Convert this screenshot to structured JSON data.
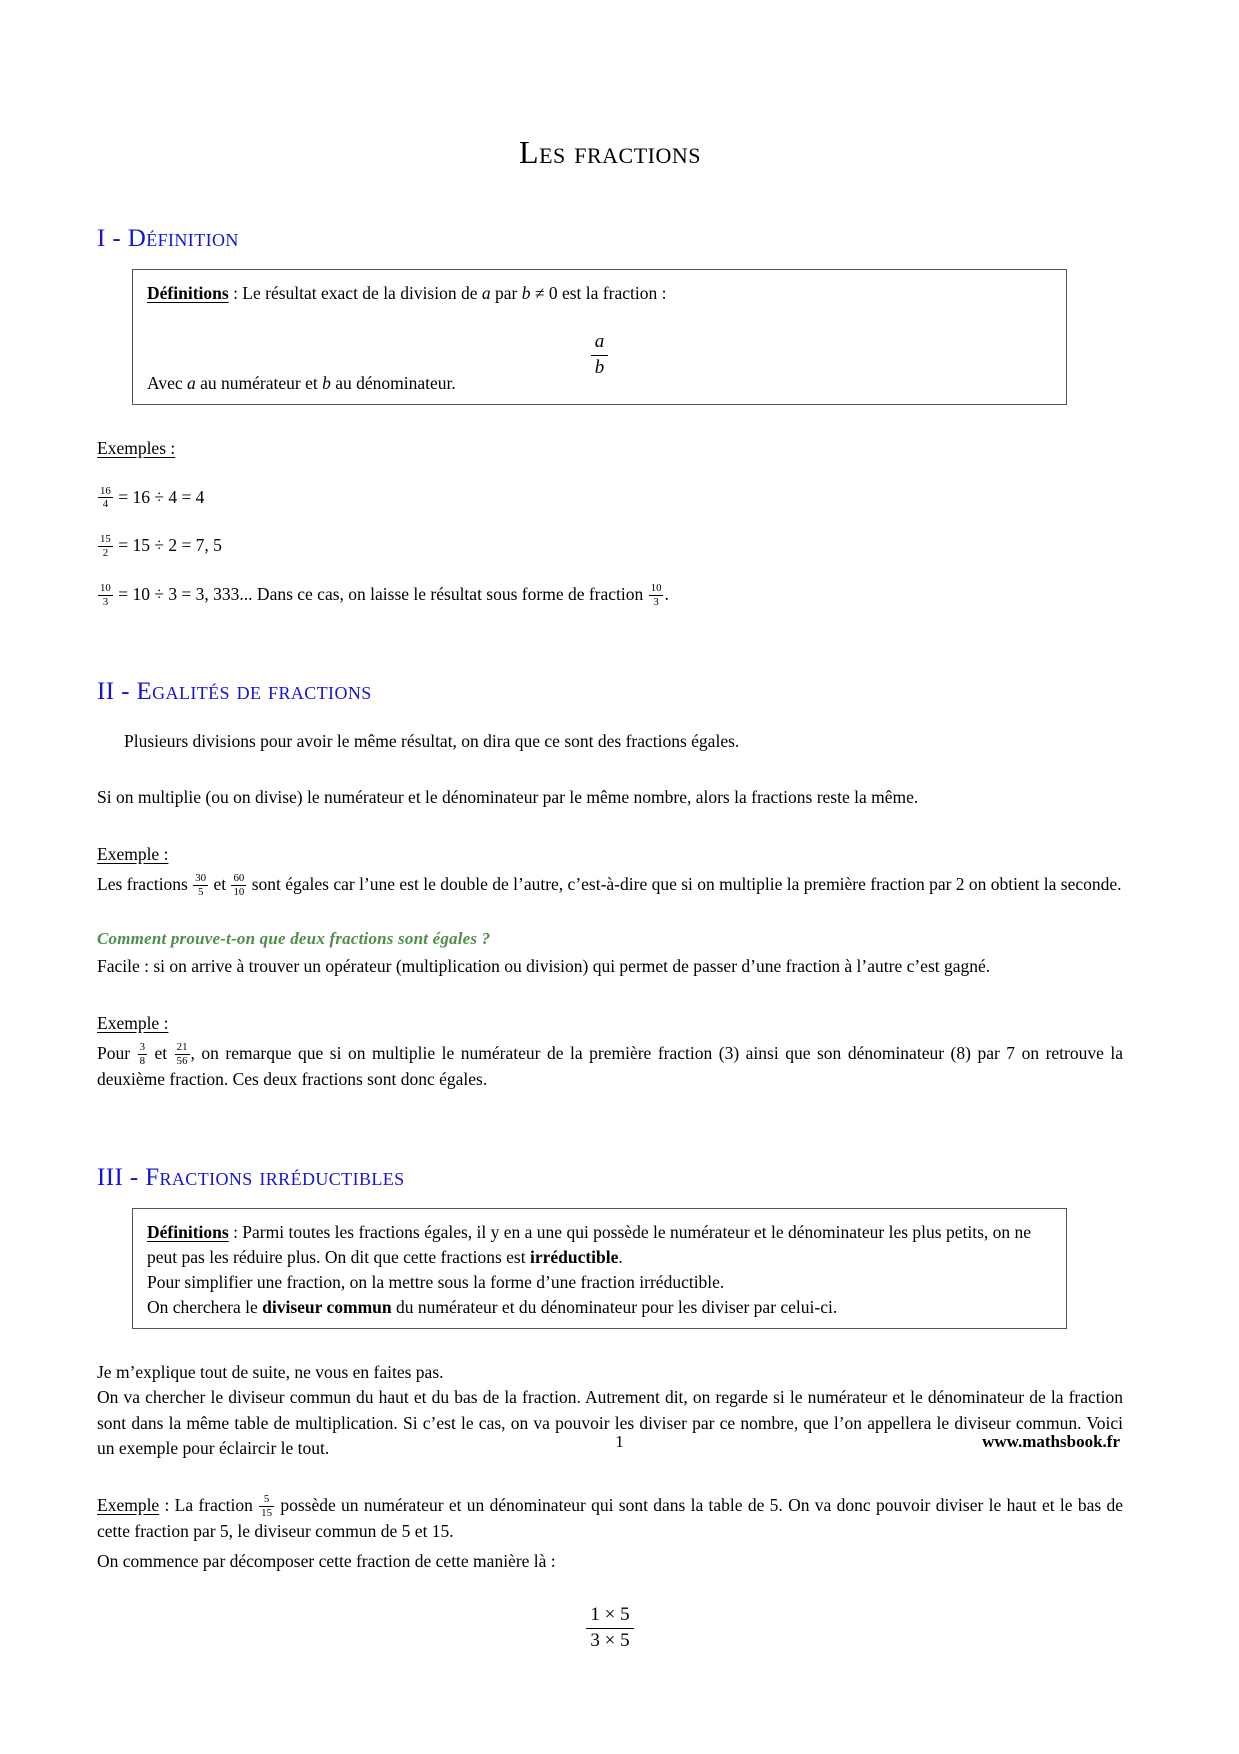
{
  "document": {
    "title": "Les fractions",
    "page_number": "1",
    "site_url": "www.mathsbook.fr"
  },
  "sections": [
    {
      "heading": "I - Définition",
      "definition_box": {
        "label": "Définitions",
        "label_suffix": " : Le résultat exact de la division de ",
        "var_a": "a",
        "mid_text": " par ",
        "var_b": "b",
        "condition": " ≠ 0 est la fraction :",
        "formula_num": "a",
        "formula_den": "b",
        "closing_prefix": "Avec ",
        "closing_a": "a",
        "closing_mid": " au numérateur et ",
        "closing_b": "b",
        "closing_suffix": " au dénominateur."
      },
      "examples_label": "Exemples :",
      "examples": [
        {
          "num": "16",
          "den": "4",
          "text": "= 16 ÷ 4 = 4"
        },
        {
          "num": "15",
          "den": "2",
          "text": "= 15 ÷ 2 = 7, 5"
        },
        {
          "num": "10",
          "den": "3",
          "text": "= 10 ÷ 3 = 3, 333... Dans ce cas, on laisse le résultat sous forme de fraction",
          "trailing_num": "10",
          "trailing_den": "3",
          "trailing_text": "."
        }
      ]
    },
    {
      "heading": "II - Egalités de fractions",
      "para1": "Plusieurs divisions pour avoir le même résultat, on dira que ce sont des fractions égales.",
      "para2": "Si on multiplie (ou on divise) le numérateur et le dénominateur par le même nombre, alors la fractions reste la même.",
      "example1_label": "Exemple :",
      "example1_prefix": "Les fractions",
      "example1_frac1": {
        "num": "30",
        "den": "5"
      },
      "example1_conj": "et",
      "example1_frac2": {
        "num": "60",
        "den": "10"
      },
      "example1_text": "sont égales car l’une est le double de l’autre, c’est-à-dire que si on multiplie la première fraction par 2 on obtient la seconde.",
      "green_question": "Comment prouve-t-on que deux fractions sont égales ?",
      "answer": "Facile : si on arrive à trouver un opérateur (multiplication ou division) qui permet de passer d’une fraction à l’autre c’est gagné.",
      "example2_label": "Exemple :",
      "example2_prefix": "Pour",
      "example2_frac1": {
        "num": "3",
        "den": "8"
      },
      "example2_conj": "et",
      "example2_frac2": {
        "num": "21",
        "den": "56"
      },
      "example2_text": ", on remarque que si on multiplie le numérateur de la première fraction (3) ainsi que son dénominateur (8) par 7 on retrouve la deuxième fraction. Ces deux fractions sont donc égales."
    },
    {
      "heading": "III - Fractions irréductibles",
      "definition_box": {
        "label": "Définitions",
        "line1_a": " : Parmi toutes les fractions égales, il y en a une qui possède le numérateur et le dénominateur les plus petits, on ne peut pas les réduire plus. On dit que cette fractions est ",
        "line1_bold": "irréductible",
        "line1_end": ".",
        "line2": "Pour simplifier une fraction, on la mettre sous la forme d’une fraction irréductible.",
        "line3_a": "On cherchera le ",
        "line3_bold": "diviseur commun",
        "line3_b": " du numérateur et du dénominateur pour les diviser par celui-ci."
      },
      "para1": "Je m’explique tout de suite, ne vous en faites pas.",
      "para2": "On va chercher le diviseur commun du haut et du bas de la fraction. Autrement dit, on regarde si le numérateur et le dénominateur de la fraction sont dans la même table de multiplication. Si c’est le cas, on va pouvoir les diviser par ce nombre, que l’on appellera le diviseur commun. Voici un exemple pour éclaircir le tout.",
      "example_label": "Exemple",
      "example_prefix": " : La fraction",
      "example_frac": {
        "num": "5",
        "den": "15"
      },
      "example_text": "possède un numérateur et un dénominateur qui sont dans la table de 5. On va donc pouvoir diviser le haut et le bas de cette fraction par 5, le diviseur commun de 5 et 15.",
      "para3": "On commence par décomposer cette fraction de cette manière là :",
      "display_formula": {
        "num": "1 × 5",
        "den": "3 × 5"
      }
    }
  ],
  "colors": {
    "heading_blue": "#1414d2",
    "question_green": "#4e8f48",
    "text_black": "#000000",
    "box_border": "#555555"
  }
}
